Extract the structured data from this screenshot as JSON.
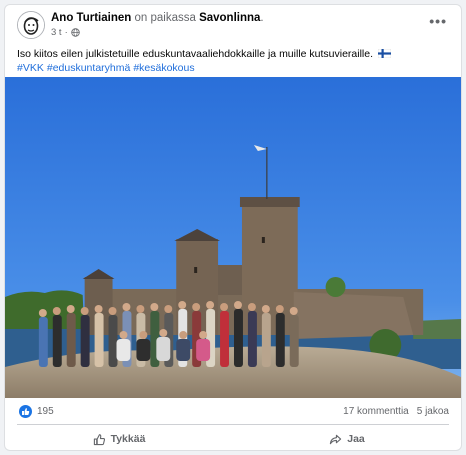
{
  "post": {
    "author": "Ano Turtiainen",
    "at_text": "on paikassa",
    "place": "Savonlinna",
    "time": "3 t",
    "more_icon": "more-horizontal-icon",
    "text": "Iso kiitos eilen julkistetuille eduskuntavaaliehdokkaille ja muille kutsuvieraille.",
    "hashtags": [
      "#VKK",
      "#eduskuntaryhmä",
      "#kesäkokous"
    ]
  },
  "stats": {
    "reaction_count": "195",
    "comments": "17 kommenttia",
    "shares": "5 jakoa"
  },
  "actions": {
    "like_label": "Tykkää",
    "share_label": "Jaa"
  },
  "colors": {
    "link": "#216fdb",
    "like_blue": "#1b74e4",
    "secondary_text": "#65676b",
    "sky": "#2f78de"
  }
}
